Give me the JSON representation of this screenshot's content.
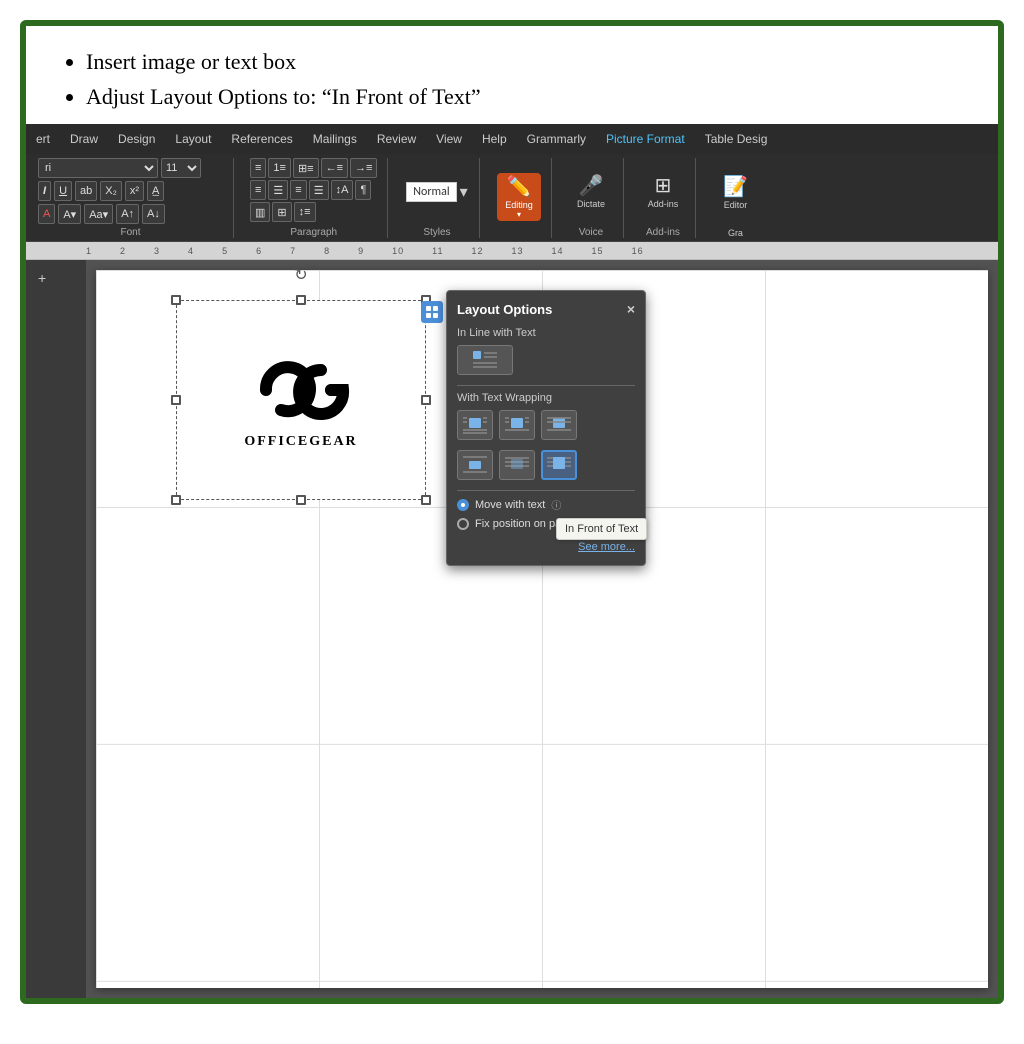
{
  "outer": {
    "border_color": "#2d6a1f"
  },
  "instructions": {
    "bullet1": "Insert image or text box",
    "bullet2": "Adjust Layout Options to: “In Front of Text”"
  },
  "ribbon": {
    "tabs": [
      "ert",
      "Draw",
      "Design",
      "Layout",
      "References",
      "Mailings",
      "Review",
      "View",
      "Help",
      "Grammarly",
      "Picture Format",
      "Table Design"
    ],
    "active_tab": "Picture Format",
    "font_name": "ri",
    "font_size": "11",
    "groups": [
      {
        "label": "Font"
      },
      {
        "label": "Paragraph"
      },
      {
        "label": "Styles"
      },
      {
        "label": "Voice"
      },
      {
        "label": "Add-ins"
      },
      {
        "label": "Gra"
      }
    ],
    "buttons": {
      "styles": "Styles",
      "editing": "Editing",
      "dictate": "Dictate",
      "add_ins": "Add-ins",
      "editor": "Editor"
    }
  },
  "ruler": {
    "marks": [
      "1",
      "2",
      "3",
      "4",
      "5",
      "6",
      "7",
      "8",
      "9",
      "10",
      "11",
      "12",
      "13",
      "14",
      "15",
      "16"
    ]
  },
  "document": {
    "logo_brand": "OG",
    "logo_name": "OfficeGear"
  },
  "layout_options_panel": {
    "title": "Layout Options",
    "close_btn": "×",
    "section1_title": "In Line with Text",
    "section2_title": "With Text Wrapping",
    "radio1": "Move with text",
    "radio2": "Fix position on page",
    "see_more": "See more..."
  },
  "tooltip": {
    "text": "In Front of Text"
  }
}
